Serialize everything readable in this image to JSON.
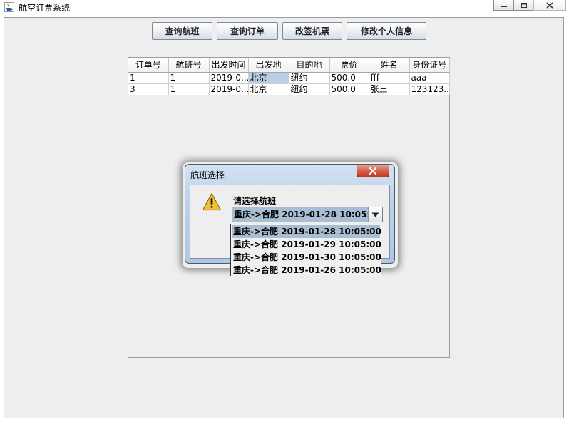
{
  "window": {
    "title": "航空订票系统",
    "icon": "java-cup-icon"
  },
  "toolbar": {
    "buttons": [
      {
        "label": "查询航班"
      },
      {
        "label": "查询订单"
      },
      {
        "label": "改签机票"
      },
      {
        "label": "修改个人信息"
      }
    ]
  },
  "orders_table": {
    "columns": [
      "订单号",
      "航班号",
      "出发时间",
      "出发地",
      "目的地",
      "票价",
      "姓名",
      "身份证号"
    ],
    "rows": [
      [
        "1",
        "1",
        "2019-0...",
        "北京",
        "纽约",
        "500.0",
        "fff",
        "aaa"
      ],
      [
        "3",
        "1",
        "2019-0...",
        "北京",
        "纽约",
        "500.0",
        "张三",
        "123123..."
      ]
    ]
  },
  "dialog": {
    "title": "航班选择",
    "prompt": "请选择航班",
    "icon": "warning-icon",
    "selected_value": "重庆->合肥 2019-01-28 10:05:00",
    "options": [
      "重庆->合肥 2019-01-28 10:05:00",
      "重庆->合肥 2019-01-29 10:05:00",
      "重庆->合肥 2019-01-30 10:05:00",
      "重庆->合肥 2019-01-26 10:05:00"
    ]
  },
  "colors": {
    "selection": "#a9bdd3",
    "cell_selection": "#b8cfe5",
    "panel_bg": "#eeeeee",
    "close_button": "#c5381f"
  }
}
